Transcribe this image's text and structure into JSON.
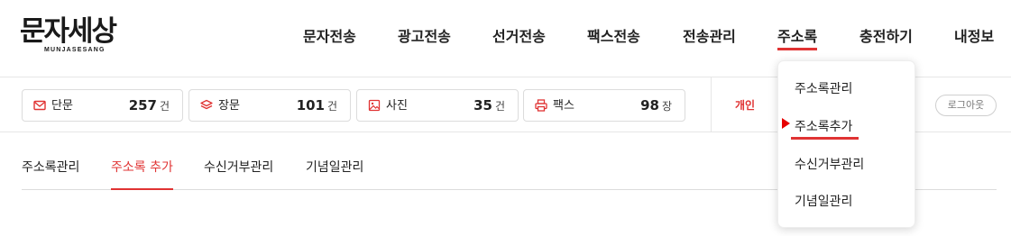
{
  "logo": {
    "main": "문자세상",
    "sub": "MUNJASESANG"
  },
  "nav": [
    {
      "label": "문자전송",
      "active": false
    },
    {
      "label": "광고전송",
      "active": false
    },
    {
      "label": "선거전송",
      "active": false
    },
    {
      "label": "팩스전송",
      "active": false
    },
    {
      "label": "전송관리",
      "active": false
    },
    {
      "label": "주소록",
      "active": true
    },
    {
      "label": "충전하기",
      "active": false
    },
    {
      "label": "내정보",
      "active": false
    }
  ],
  "stats": [
    {
      "icon": "mail-icon",
      "label": "단문",
      "value": "257",
      "unit": "건"
    },
    {
      "icon": "layers-icon",
      "label": "장문",
      "value": "101",
      "unit": "건"
    },
    {
      "icon": "image-icon",
      "label": "사진",
      "value": "35",
      "unit": "건"
    },
    {
      "icon": "printer-icon",
      "label": "팩스",
      "value": "98",
      "unit": "장"
    }
  ],
  "account": {
    "type": "개인",
    "logout": "로그아웃"
  },
  "tabs": [
    {
      "label": "주소록관리",
      "active": false
    },
    {
      "label": "주소록 추가",
      "active": true
    },
    {
      "label": "수신거부관리",
      "active": false
    },
    {
      "label": "기념일관리",
      "active": false
    }
  ],
  "dropdown": {
    "items": [
      {
        "label": "주소록관리",
        "current": false
      },
      {
        "label": "주소록추가",
        "current": true
      },
      {
        "label": "수신거부관리",
        "current": false
      },
      {
        "label": "기념일관리",
        "current": false
      }
    ]
  },
  "colors": {
    "accent": "#e03333",
    "marker": "#e60000",
    "text": "#222222",
    "border": "#dcdcdc"
  }
}
